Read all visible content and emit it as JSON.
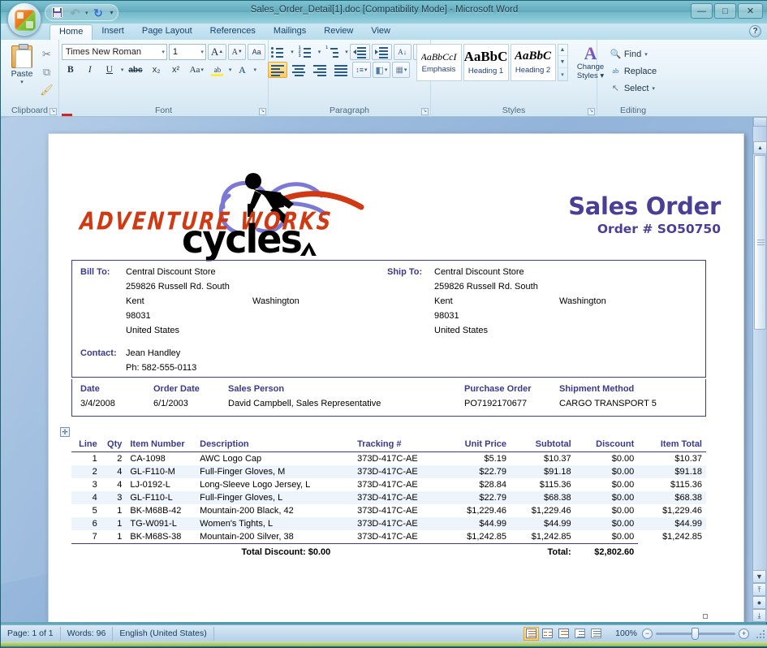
{
  "window": {
    "title": "Sales_Order_Detail[1].doc [Compatibility Mode] - Microsoft Word",
    "minimize_label": "—",
    "maximize_label": "□",
    "close_label": "✕",
    "office_button_name": "Office Button"
  },
  "quick_access": {
    "save_label": "💾",
    "undo_label": "↶",
    "undo_caret": "▾",
    "redo_label": "↻",
    "customize_label": "▾"
  },
  "ribbon": {
    "tabs": [
      {
        "label": "Home",
        "active": true
      },
      {
        "label": "Insert",
        "active": false
      },
      {
        "label": "Page Layout",
        "active": false
      },
      {
        "label": "References",
        "active": false
      },
      {
        "label": "Mailings",
        "active": false
      },
      {
        "label": "Review",
        "active": false
      },
      {
        "label": "View",
        "active": false
      }
    ],
    "help_label": "?",
    "groups": {
      "clipboard": {
        "label": "Clipboard",
        "paste_label": "Paste",
        "paste_caret": "▾",
        "cut_label": "✂",
        "copy_label": "⧉",
        "format_painter_label": "🖌",
        "dialog_launcher": "↘"
      },
      "font": {
        "label": "Font",
        "font_name": "Times New Roman",
        "font_size": "1",
        "grow_font_label": "A",
        "shrink_font_label": "A",
        "clear_formatting_label": "Aa",
        "bold_label": "B",
        "italic_label": "I",
        "underline_label": "U",
        "strikethrough_label": "abc",
        "subscript_label": "x₂",
        "superscript_label": "x²",
        "change_case_label": "Aa",
        "highlight_label": "ab",
        "font_color_label": "A",
        "caret": "▾",
        "dialog_launcher": "↘"
      },
      "paragraph": {
        "label": "Paragraph",
        "bullets_label": "•☰",
        "numbering_label": "1☰",
        "multilevel_label": "☰",
        "decrease_indent_label": "←≡",
        "increase_indent_label": "→≡",
        "sort_label": "A↓",
        "show_marks_label": "¶",
        "align_left_label": "≡",
        "align_center_label": "≡",
        "align_right_label": "≡",
        "justify_label": "≡",
        "line_spacing_label": "↕≡",
        "shading_label": "◧",
        "borders_label": "▦",
        "caret": "▾",
        "dialog_launcher": "↘"
      },
      "styles": {
        "label": "Styles",
        "items": [
          {
            "preview": "AaBbCcI",
            "name": "Emphasis"
          },
          {
            "preview": "AaBbC",
            "name": "Heading 1"
          },
          {
            "preview": "AaBbC",
            "name": "Heading 2"
          }
        ],
        "scroll_up": "▲",
        "scroll_down": "▼",
        "more": "▾",
        "change_styles_line1": "Change",
        "change_styles_line2": "Styles ▾",
        "change_styles_icon": "A",
        "dialog_launcher": "↘"
      },
      "editing": {
        "label": "Editing",
        "find_label": "Find",
        "find_caret": "▾",
        "replace_label": "Replace",
        "select_label": "Select",
        "select_caret": "▾",
        "find_icon": "🔍",
        "replace_icon": "ab",
        "select_icon": "↖"
      }
    }
  },
  "document": {
    "logo": {
      "line1": "ADVENTURE WORKS",
      "line2": "cycles",
      "color_text": "#cf3a14"
    },
    "title": "Sales Order",
    "order_number": "Order # SO50750",
    "bill_to": {
      "label": "Bill To:",
      "name": "Central Discount Store",
      "street": "259826 Russell Rd. South",
      "city": "Kent",
      "state": "Washington",
      "zip": "98031",
      "country": "United States"
    },
    "ship_to": {
      "label": "Ship To:",
      "name": "Central Discount Store",
      "street": "259826 Russell Rd. South",
      "city": "Kent",
      "state": "Washington",
      "zip": "98031",
      "country": "United States"
    },
    "contact": {
      "label": "Contact:",
      "name": "Jean Handley",
      "phone": "Ph: 582-555-0113"
    },
    "info": {
      "date_label": "Date",
      "date_value": "3/4/2008",
      "order_date_label": "Order Date",
      "order_date_value": "6/1/2003",
      "sales_person_label": "Sales Person",
      "sales_person_value": "David Campbell, Sales Representative",
      "purchase_order_label": "Purchase Order",
      "purchase_order_value": "PO7192170677",
      "shipment_method_label": "Shipment Method",
      "shipment_method_value": "CARGO TRANSPORT  5"
    },
    "table": {
      "headers": {
        "line": "Line",
        "qty": "Qty",
        "item_number": "Item Number",
        "description": "Description",
        "tracking": "Tracking #",
        "unit_price": "Unit Price",
        "subtotal": "Subtotal",
        "discount": "Discount",
        "item_total": "Item Total"
      },
      "rows": [
        {
          "line": "1",
          "qty": "2",
          "item": "CA-1098",
          "desc": "AWC Logo Cap",
          "tracking": "373D-417C-AE",
          "unit": "$5.19",
          "subtotal": "$10.37",
          "discount": "$0.00",
          "total": "$10.37"
        },
        {
          "line": "2",
          "qty": "4",
          "item": "GL-F110-M",
          "desc": "Full-Finger Gloves, M",
          "tracking": "373D-417C-AE",
          "unit": "$22.79",
          "subtotal": "$91.18",
          "discount": "$0.00",
          "total": "$91.18"
        },
        {
          "line": "3",
          "qty": "4",
          "item": "LJ-0192-L",
          "desc": "Long-Sleeve Logo Jersey, L",
          "tracking": "373D-417C-AE",
          "unit": "$28.84",
          "subtotal": "$115.36",
          "discount": "$0.00",
          "total": "$115.36"
        },
        {
          "line": "4",
          "qty": "3",
          "item": "GL-F110-L",
          "desc": "Full-Finger Gloves, L",
          "tracking": "373D-417C-AE",
          "unit": "$22.79",
          "subtotal": "$68.38",
          "discount": "$0.00",
          "total": "$68.38"
        },
        {
          "line": "5",
          "qty": "1",
          "item": "BK-M68B-42",
          "desc": "Mountain-200 Black, 42",
          "tracking": "373D-417C-AE",
          "unit": "$1,229.46",
          "subtotal": "$1,229.46",
          "discount": "$0.00",
          "total": "$1,229.46"
        },
        {
          "line": "6",
          "qty": "1",
          "item": "TG-W091-L",
          "desc": "Women's Tights, L",
          "tracking": "373D-417C-AE",
          "unit": "$44.99",
          "subtotal": "$44.99",
          "discount": "$0.00",
          "total": "$44.99"
        },
        {
          "line": "7",
          "qty": "1",
          "item": "BK-M68S-38",
          "desc": "Mountain-200 Silver, 38",
          "tracking": "373D-417C-AE",
          "unit": "$1,242.85",
          "subtotal": "$1,242.85",
          "discount": "$0.00",
          "total": "$1,242.85"
        }
      ],
      "footer": {
        "total_discount_label": "Total Discount:",
        "total_discount_value": "$0.00",
        "total_label": "Total:",
        "total_value": "$2,802.60"
      }
    },
    "colors": {
      "heading_purple": "#4a3f96",
      "label_blue": "#3a3a8c",
      "discount_green": "#15802f",
      "alt_row": "#eef4fb"
    }
  },
  "scrollbar": {
    "split_label": "",
    "up_label": "▲",
    "down_label": "▼",
    "prev_page_label": "⤒",
    "browse_object_label": "●",
    "next_page_label": "⤓"
  },
  "status_bar": {
    "page_label": "Page: 1 of 1",
    "words_label": "Words: 96",
    "language_label": "English (United States)",
    "zoom_label": "100%",
    "zoom_out_label": "−",
    "zoom_in_label": "+",
    "views": [
      {
        "name": "print-layout",
        "active": true
      },
      {
        "name": "full-screen-reading",
        "active": false
      },
      {
        "name": "web-layout",
        "active": false
      },
      {
        "name": "outline",
        "active": false
      },
      {
        "name": "draft",
        "active": false
      }
    ]
  }
}
